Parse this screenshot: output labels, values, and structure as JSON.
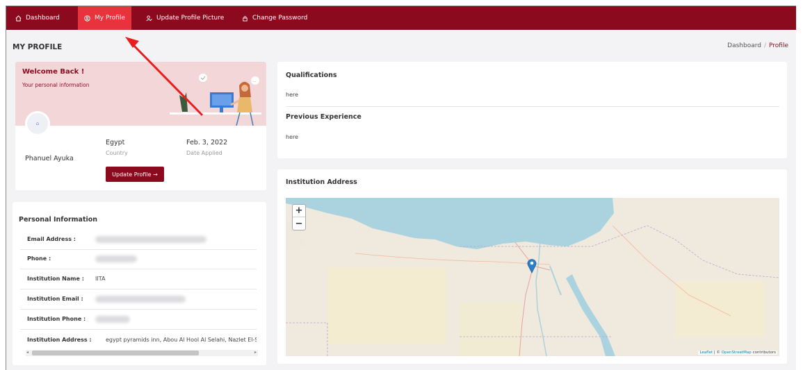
{
  "nav": {
    "items": [
      {
        "label": "Dashboard",
        "icon": "home-icon"
      },
      {
        "label": "My Profile",
        "icon": "user-circle-icon",
        "active": true
      },
      {
        "label": "Update Profile Picture",
        "icon": "user-edit-icon"
      },
      {
        "label": "Change Password",
        "icon": "lock-icon"
      }
    ]
  },
  "page": {
    "title": "MY PROFILE"
  },
  "breadcrumb": {
    "items": [
      "Dashboard",
      "Profile"
    ],
    "separator": "/"
  },
  "welcome": {
    "title": "Welcome Back !",
    "subtitle": "Your personal information",
    "name": "Phanuel Ayuka",
    "country": "Egypt",
    "country_label": "Country",
    "date_applied": "Feb. 3, 2022",
    "date_label": "Date Applied",
    "button_label": "Update Profile →"
  },
  "personal": {
    "heading": "Personal Information",
    "rows": [
      {
        "label": "Email Address :",
        "value": "",
        "blurred": true
      },
      {
        "label": "Phone :",
        "value": "",
        "blurred": true
      },
      {
        "label": "Institution Name :",
        "value": "IITA",
        "blurred": false
      },
      {
        "label": "Institution Email :",
        "value": "",
        "blurred": true
      },
      {
        "label": "Institution Phone :",
        "value": "",
        "blurred": true
      },
      {
        "label": "Institution Address :",
        "value": "egypt pyramids inn, Abou Al Hool Al Selahi, Nazlet El-Se",
        "blurred": false
      }
    ]
  },
  "qualifications": {
    "heading": "Qualifications",
    "text": "here"
  },
  "experience": {
    "heading": "Previous Experience",
    "text": "here"
  },
  "address": {
    "heading": "Institution Address",
    "zoom_in": "+",
    "zoom_out": "−",
    "attribution_leaflet": "Leaflet",
    "attribution_sep": " | © ",
    "attribution_osm": "OpenStreetMap",
    "attribution_tail": " contributors"
  },
  "colors": {
    "brand": "#8c0a1e",
    "active_tab": "#e8323c",
    "annotation_arrow": "#e81e1e",
    "marker": "#2a81cb"
  }
}
